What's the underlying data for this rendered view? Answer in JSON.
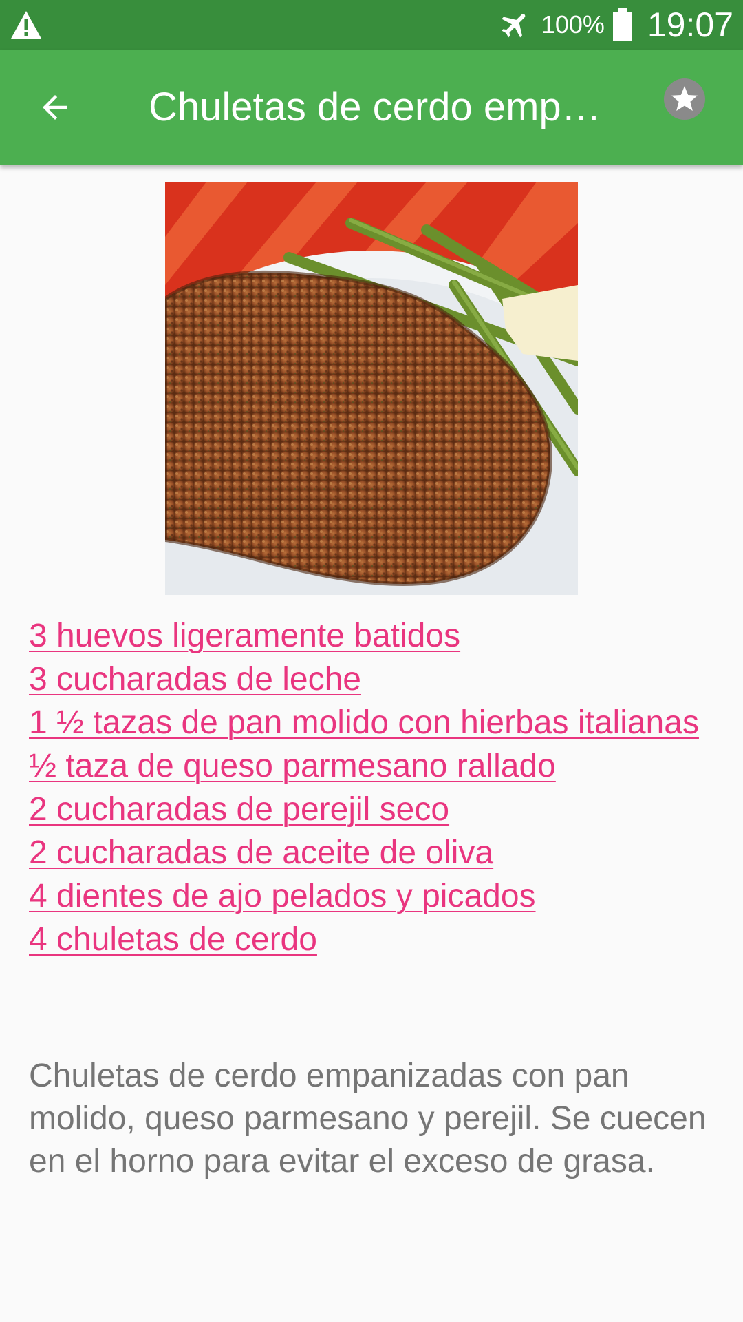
{
  "status_bar": {
    "battery_percent": "100%",
    "time": "19:07",
    "icons": [
      "warning-icon",
      "airplane-mode-icon",
      "battery-icon"
    ]
  },
  "app_bar": {
    "title": "Chuletas de cerdo empanizadas",
    "back_icon": "arrow-back-icon",
    "favorite_icon": "star-icon"
  },
  "ingredients": [
    "3 huevos ligeramente batidos",
    "3 cucharadas de leche",
    "1 ½ tazas de pan molido con hierbas italianas",
    "½ taza de queso parmesano rallado",
    "2 cucharadas de perejil seco",
    "2 cucharadas de aceite de oliva",
    "4 dientes de ajo pelados y picados",
    "4 chuletas de cerdo"
  ],
  "description": "Chuletas de cerdo empanizadas con pan molido, queso parmesano y perejil. Se cuecen en el horno para evitar el exceso de grasa.",
  "colors": {
    "status_bar": "#388e3c",
    "app_bar": "#4caf50",
    "ingredient_link": "#e9357f",
    "description_text": "#757575"
  }
}
